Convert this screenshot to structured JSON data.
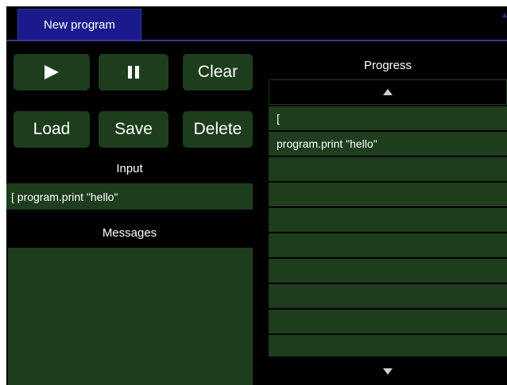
{
  "tabs": [
    {
      "label": "New program"
    }
  ],
  "toolbar": {
    "play_icon": "play-icon",
    "pause_icon": "pause-icon",
    "clear_label": "Clear",
    "load_label": "Load",
    "save_label": "Save",
    "delete_label": "Delete"
  },
  "input": {
    "label": "Input",
    "value": "[ program.print \"hello\""
  },
  "messages": {
    "label": "Messages"
  },
  "progress": {
    "label": "Progress",
    "scroll_up_icon": "triangle-up-icon",
    "scroll_down_icon": "triangle-down-icon",
    "rows": [
      "[",
      "program.print \"hello\"",
      "",
      "",
      "",
      "",
      "",
      "",
      "",
      "",
      ""
    ]
  },
  "colors": {
    "background": "#000000",
    "panel": "#1d3d1d",
    "tab": "#1a1a8c",
    "text": "#ffffff"
  }
}
